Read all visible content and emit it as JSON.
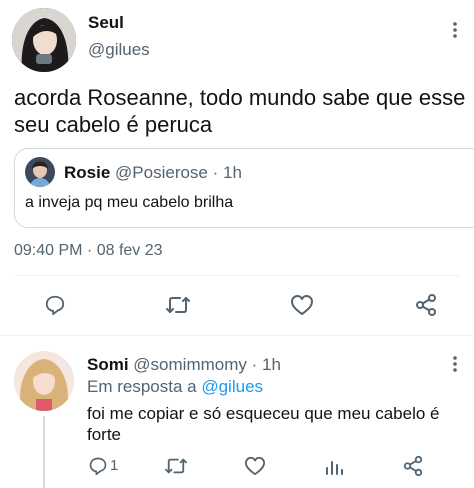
{
  "main_tweet": {
    "display_name": "Seul",
    "handle": "@gilues",
    "text_line1": "acorda Roseanne, todo mundo sabe que esse",
    "text_line2": "seu cabelo é peruca",
    "timestamp": "09:40 PM · 08 fev 23"
  },
  "quoted_tweet": {
    "display_name": "Rosie",
    "handle": "@Posierose",
    "separator": "·",
    "time_ago": "1h",
    "text": "a inveja pq meu cabelo brilha"
  },
  "reply": {
    "display_name": "Somi",
    "handle": "@somimmomy",
    "separator": "·",
    "time_ago": "1h",
    "in_reply_prefix": "Em resposta a",
    "in_reply_handle": "@gilues",
    "text_line1": "foi me copiar e só esqueceu que meu cabelo é",
    "text_line2": "forte",
    "reply_count": "1"
  },
  "icons": {
    "more": "more-vertical-icon",
    "reply": "reply-icon",
    "retweet": "retweet-icon",
    "like": "heart-icon",
    "share": "share-icon",
    "views": "analytics-icon"
  },
  "colors": {
    "accent": "#1d9bf0",
    "text": "#0f1419",
    "muted": "#536471",
    "border": "#cfd9de"
  }
}
